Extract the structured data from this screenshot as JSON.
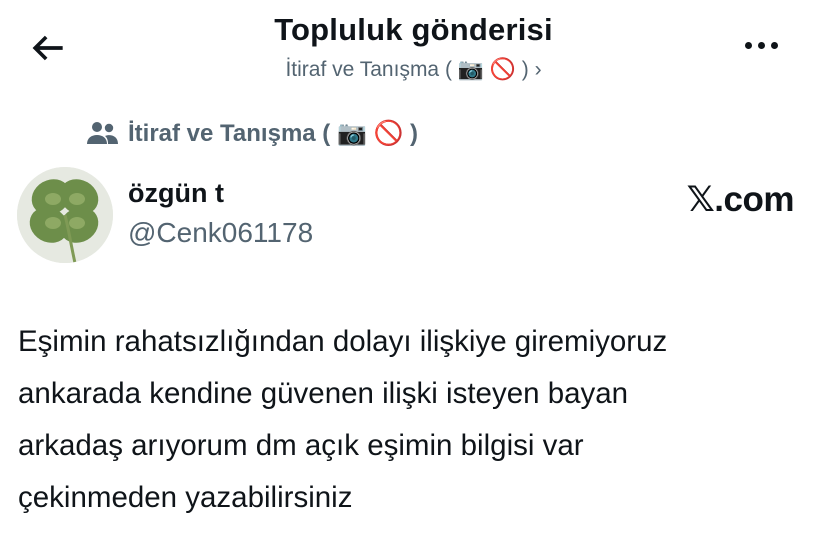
{
  "header": {
    "title": "Topluluk gönderisi",
    "subtitle": "İtiraf ve Tanışma ( 📷 🚫 ) ›",
    "back_icon": "arrow-left-icon",
    "more_icon": "more-horizontal-icon"
  },
  "community": {
    "label": "İtiraf ve Tanışma ( 📷 🚫 )",
    "icon": "people-icon"
  },
  "author": {
    "display_name": "özgün t",
    "handle": "@Cenk061178",
    "avatar": "four-leaf-clover-avatar"
  },
  "brand": "𝕏.com",
  "post": {
    "lines": [
      "Eşimin rahatsızlığından dolayı ilişkiye giremiyoruz",
      "ankarada kendine güvenen ilişki isteyen bayan",
      "arkadaş arıyorum dm açık eşimin bilgisi var",
      "çekinmeden yazabilirsiniz"
    ]
  },
  "colors": {
    "text": "#0f1419",
    "secondary": "#536471",
    "background": "#ffffff"
  }
}
